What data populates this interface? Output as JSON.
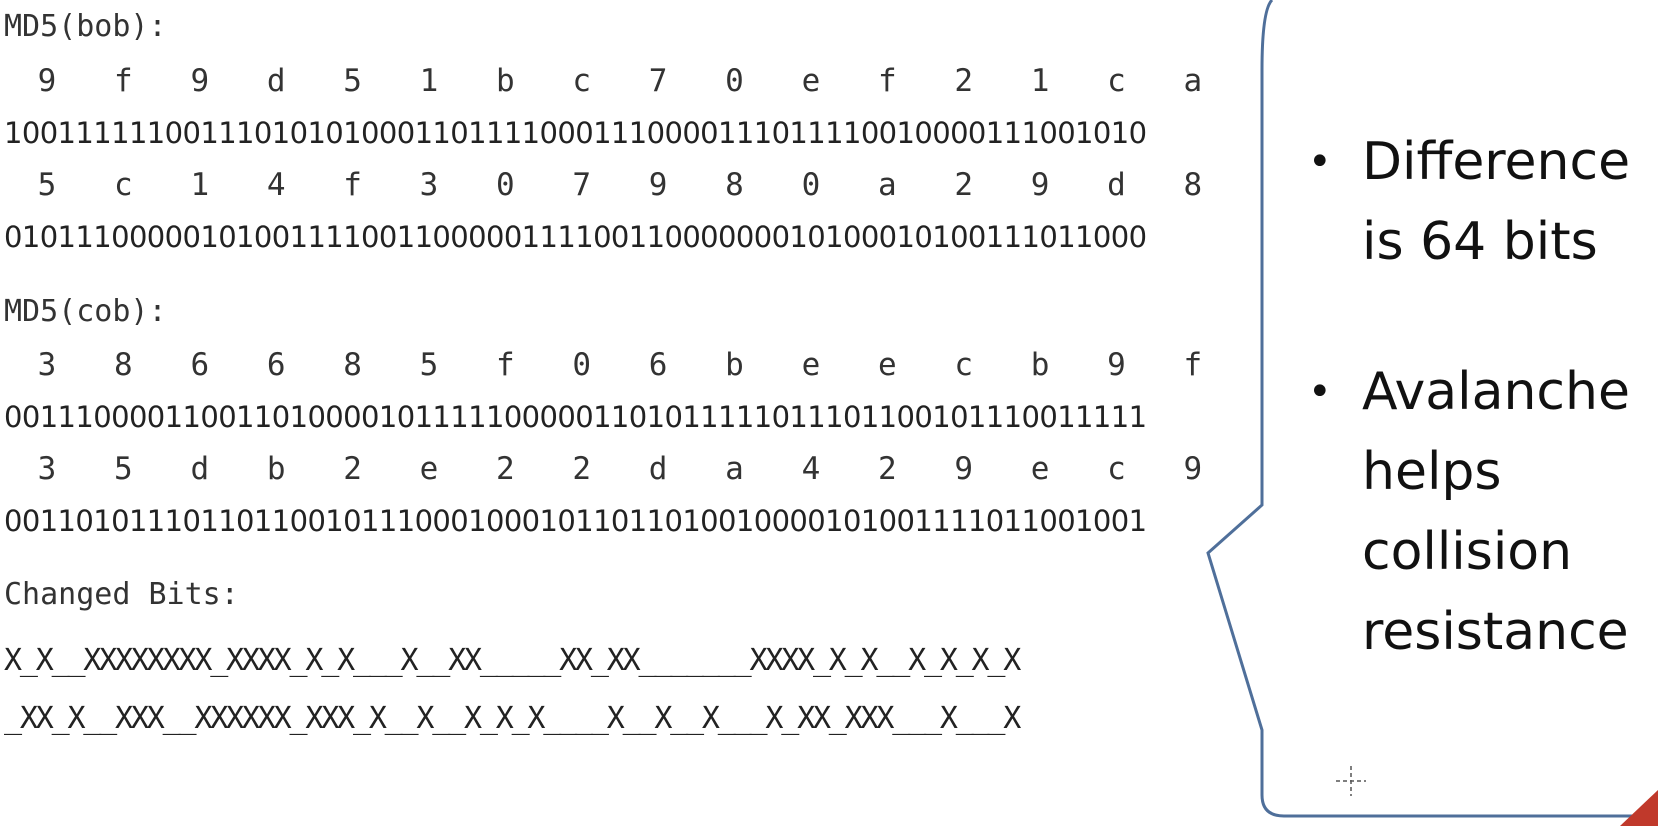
{
  "md5_bob": {
    "label": "MD5(bob):",
    "hex1": [
      "9",
      "f",
      "9",
      "d",
      "5",
      "1",
      "b",
      "c",
      "7",
      "0",
      "e",
      "f",
      "2",
      "1",
      "c",
      "a"
    ],
    "bits1": "1001111110011101010100011011110001110000111011110010000111001010",
    "hex2": [
      "5",
      "c",
      "1",
      "4",
      "f",
      "3",
      "0",
      "7",
      "9",
      "8",
      "0",
      "a",
      "2",
      "9",
      "d",
      "8"
    ],
    "bits2": "0101110000010100111100110000011110011000000010100010100111011000"
  },
  "md5_cob": {
    "label": "MD5(cob):",
    "hex1": [
      "3",
      "8",
      "6",
      "6",
      "8",
      "5",
      "f",
      "0",
      "6",
      "b",
      "e",
      "e",
      "c",
      "b",
      "9",
      "f"
    ],
    "bits1": "0011100001100110100001011111000001101011111011101100101110011111",
    "hex2": [
      "3",
      "5",
      "d",
      "b",
      "2",
      "e",
      "2",
      "2",
      "d",
      "a",
      "4",
      "2",
      "9",
      "e",
      "c",
      "9"
    ],
    "bits2": "0011010111011011001011100010001011011010010000101001111011001001"
  },
  "changed_bits": {
    "label": "Changed Bits:",
    "line1": "X_X__XXXXXXXX_XXXX_X_X___X__XX_____XX_XX_______XXXX_X_X__X_X_X_X",
    "line2": "_XX_X__XXX__XXXXXX_XXX_X__X__X_X_X____X__X__X___X_XX_XXX___X___X"
  },
  "callout": {
    "bullets": [
      "Difference is 64 bits",
      "Avalanche helps collision resistance"
    ],
    "border_color": "#4f6f9a"
  }
}
